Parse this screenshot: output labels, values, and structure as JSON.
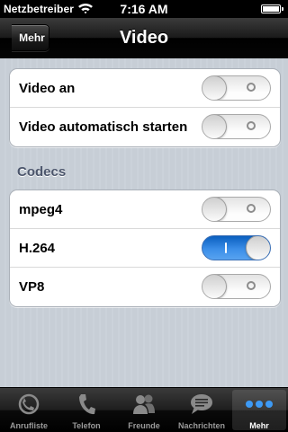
{
  "status_bar": {
    "carrier": "Netzbetreiber",
    "time": "7:16 AM"
  },
  "nav_bar": {
    "back_label": "Mehr",
    "title": "Video"
  },
  "group1": {
    "rows": [
      {
        "label": "Video an",
        "on": false
      },
      {
        "label": "Video automatisch starten",
        "on": false
      }
    ]
  },
  "codecs": {
    "header": "Codecs",
    "rows": [
      {
        "label": "mpeg4",
        "on": false
      },
      {
        "label": "H.264",
        "on": true
      },
      {
        "label": "VP8",
        "on": false
      }
    ]
  },
  "tab_bar": {
    "active_tab": 4,
    "tabs": [
      {
        "label": "Anrufliste",
        "icon": "call-history-icon"
      },
      {
        "label": "Telefon",
        "icon": "phone-icon"
      },
      {
        "label": "Freunde",
        "icon": "friends-icon"
      },
      {
        "label": "Nachrichten",
        "icon": "chat-icon"
      },
      {
        "label": "Mehr",
        "icon": "more-icon"
      }
    ]
  },
  "colors": {
    "switch_on": "#2f86e0",
    "section_header": "#4c566c",
    "nav_bar": "#1a1a1a"
  }
}
